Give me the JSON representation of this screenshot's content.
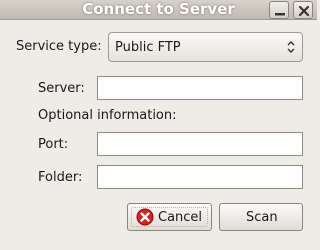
{
  "window": {
    "title": "Connect to Server",
    "minimize_icon": "minimize-icon",
    "close_icon": "close-icon"
  },
  "form": {
    "service_type_label": "Service type:",
    "service_type_value": "Public FTP",
    "server_label": "Server:",
    "server_value": "",
    "optional_label": "Optional information:",
    "port_label": "Port:",
    "port_value": "",
    "folder_label": "Folder:",
    "folder_value": ""
  },
  "buttons": {
    "cancel_label": "Cancel",
    "cancel_icon": "cancel-icon",
    "scan_label": "Scan"
  },
  "colors": {
    "window_bg": "#efebe7",
    "cancel_icon_red": "#d9201a"
  }
}
